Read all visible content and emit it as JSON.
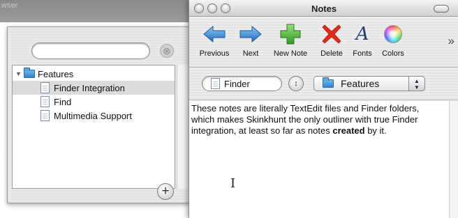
{
  "background_window": {
    "title_fragment": "wser",
    "search": {
      "value": "",
      "placeholder": ""
    },
    "outline": {
      "folder": "Features",
      "items": [
        "Finder Integration",
        "Find",
        "Multimedia Support"
      ],
      "selected": "Finder Integration"
    }
  },
  "window": {
    "title": "Notes"
  },
  "toolbar": {
    "items": [
      {
        "label": "Previous",
        "icon": "arrow-left-icon"
      },
      {
        "label": "Next",
        "icon": "arrow-right-icon"
      },
      {
        "label": "New Note",
        "icon": "plus-icon"
      },
      {
        "label": "Delete",
        "icon": "x-icon"
      },
      {
        "label": "Fonts",
        "icon": "font-icon"
      },
      {
        "label": "Colors",
        "icon": "color-wheel-icon"
      }
    ],
    "overflow": "»"
  },
  "nav": {
    "path_label": "Finder",
    "folder_popup": "Features"
  },
  "note": {
    "text_before": "These notes are literally TextEdit files and Finder folders, which makes Skinkhunt the only outliner with true Finder integration, at least so far as notes ",
    "bold_word": "created",
    "text_after": " by it."
  },
  "colors": {
    "arrow_blue": "#2f88d6",
    "plus_green": "#3fae2a",
    "delete_red": "#e22b1a",
    "folder_blue": "#3f96dc"
  }
}
